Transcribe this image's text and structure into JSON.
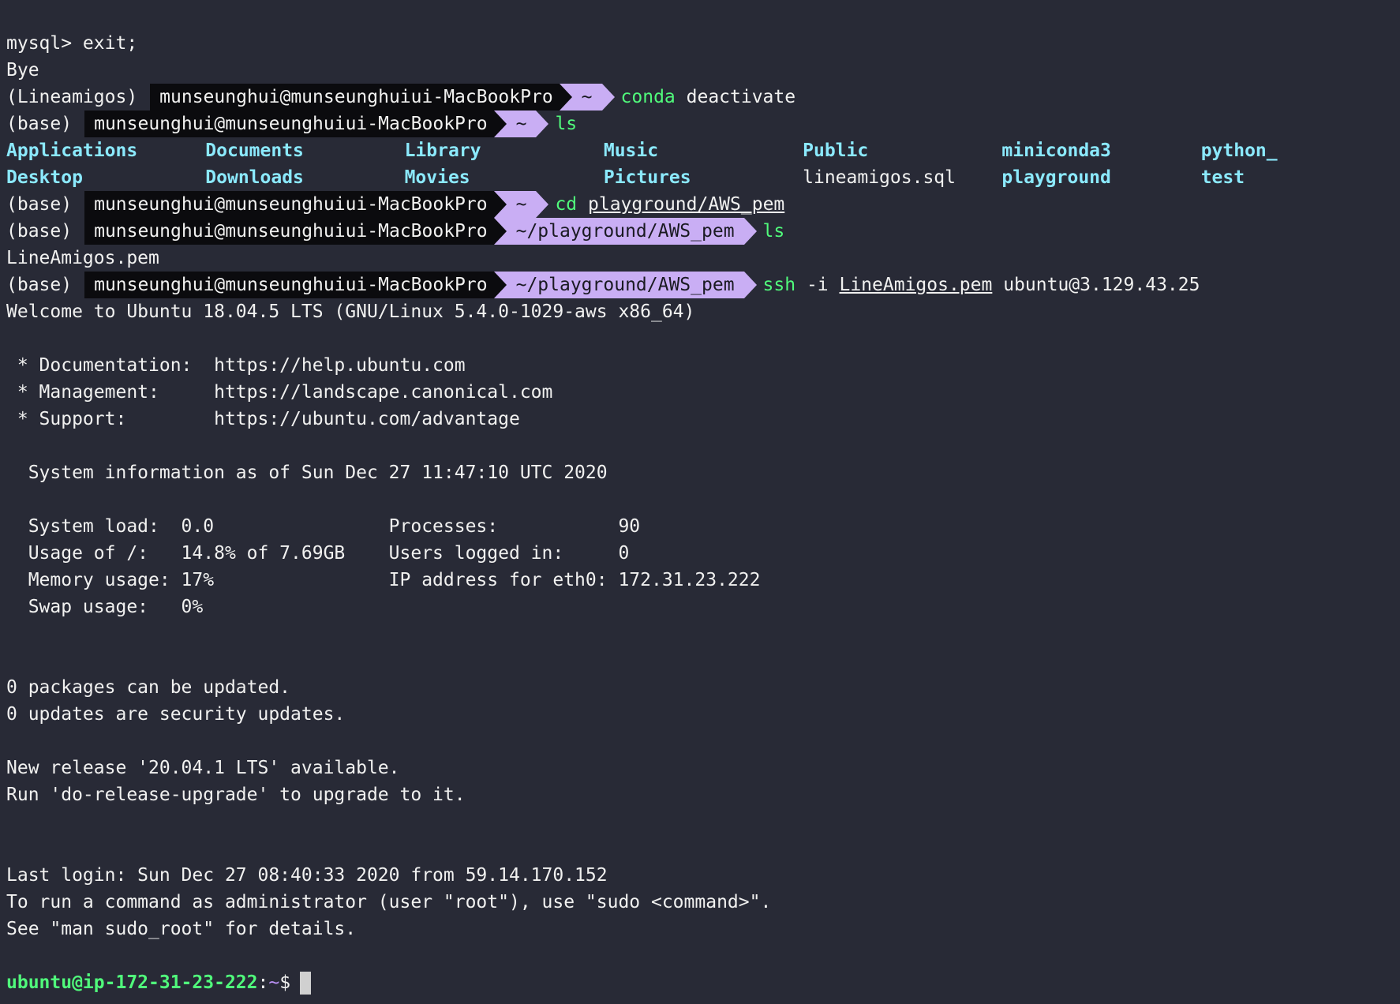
{
  "lines": {
    "mysql_exit": "mysql> exit;",
    "bye": "Bye",
    "p1_env": "(Lineamigos)",
    "p1_user": "munseunghui@munseunghuiui-MacBookPro",
    "p1_dir": "~",
    "p1_cmd": "conda",
    "p1_args": " deactivate",
    "p2_env": "(base)",
    "p2_user": "munseunghui@munseunghuiui-MacBookPro",
    "p2_dir": "~",
    "p2_cmd": "ls",
    "p3_env": "(base)",
    "p3_user": "munseunghui@munseunghuiui-MacBookPro",
    "p3_dir": "~",
    "p3_cmd": "cd",
    "p3_arg": "playground/AWS_pem",
    "p4_env": "(base)",
    "p4_user": "munseunghui@munseunghuiui-MacBookPro",
    "p4_dir": "~/playground/AWS_pem",
    "p4_cmd": "ls",
    "pem_file": "LineAmigos.pem",
    "p5_env": "(base)",
    "p5_user": "munseunghui@munseunghuiui-MacBookPro",
    "p5_dir": "~/playground/AWS_pem",
    "p5_cmd": "ssh",
    "p5_flag": " -i ",
    "p5_key": "LineAmigos.pem",
    "p5_host": " ubuntu@3.129.43.25",
    "welcome": "Welcome to Ubuntu 18.04.5 LTS (GNU/Linux 5.4.0-1029-aws x86_64)",
    "doc": " * Documentation:  https://help.ubuntu.com",
    "mgmt": " * Management:     https://landscape.canonical.com",
    "support": " * Support:        https://ubuntu.com/advantage",
    "sysinfo": "  System information as of Sun Dec 27 11:47:10 UTC 2020",
    "stat1": "  System load:  0.0                Processes:           90",
    "stat2": "  Usage of /:   14.8% of 7.69GB    Users logged in:     0",
    "stat3": "  Memory usage: 17%                IP address for eth0: 172.31.23.222",
    "stat4": "  Swap usage:   0%",
    "pkg1": "0 packages can be updated.",
    "pkg2": "0 updates are security updates.",
    "release1": "New release '20.04.1 LTS' available.",
    "release2": "Run 'do-release-upgrade' to upgrade to it.",
    "lastlogin": "Last login: Sun Dec 27 08:40:33 2020 from 59.14.170.152",
    "sudo1": "To run a command as administrator (user \"root\"), use \"sudo <command>\".",
    "sudo2": "See \"man sudo_root\" for details.",
    "final_user": "ubuntu@ip-172-31-23-222",
    "final_rest": ":~$"
  },
  "ls_home": {
    "row1": [
      {
        "name": "Applications",
        "bold": true
      },
      {
        "name": "Documents",
        "bold": true
      },
      {
        "name": "Library",
        "bold": true
      },
      {
        "name": "Music",
        "bold": true
      },
      {
        "name": "Public",
        "bold": true
      },
      {
        "name": "miniconda3",
        "bold": true
      },
      {
        "name": "python_",
        "bold": true
      }
    ],
    "row2": [
      {
        "name": "Desktop",
        "bold": true
      },
      {
        "name": "Downloads",
        "bold": true
      },
      {
        "name": "Movies",
        "bold": true
      },
      {
        "name": "Pictures",
        "bold": true
      },
      {
        "name": "lineamigos.sql",
        "bold": false
      },
      {
        "name": "playground",
        "bold": true
      },
      {
        "name": "test",
        "bold": true
      }
    ]
  },
  "colors": {
    "background": "#282a36",
    "foreground": "#f1f1f0",
    "green": "#50fa7b",
    "cyan": "#8be9fd",
    "prompt_dir_bg": "#c9aef4",
    "prompt_user_bg": "#0b0b0e"
  }
}
